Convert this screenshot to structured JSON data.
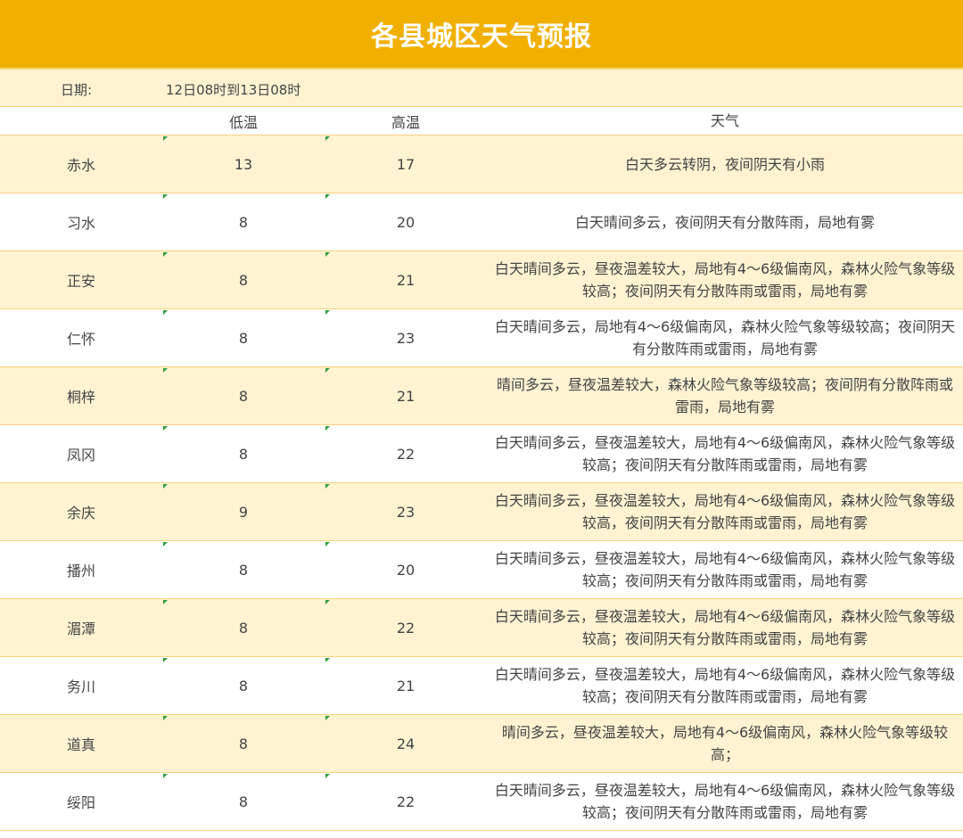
{
  "title": "各县城区天气预报",
  "date": {
    "label": "日期:",
    "value": "12日08时到13日08时"
  },
  "headers": {
    "city": "",
    "low": "低温",
    "high": "高温",
    "weather": "天气"
  },
  "rows": [
    {
      "city": "赤水",
      "low": "13",
      "high": "17",
      "weather": "白天多云转阴，夜间阴天有小雨"
    },
    {
      "city": "习水",
      "low": "8",
      "high": "20",
      "weather": "白天晴间多云，夜间阴天有分散阵雨，局地有雾"
    },
    {
      "city": "正安",
      "low": "8",
      "high": "21",
      "weather": "白天晴间多云，昼夜温差较大，局地有4～6级偏南风，森林火险气象等级较高；夜间阴天有分散阵雨或雷雨，局地有雾"
    },
    {
      "city": "仁怀",
      "low": "8",
      "high": "23",
      "weather": "白天晴间多云，局地有4～6级偏南风，森林火险气象等级较高；夜间阴天有分散阵雨或雷雨，局地有雾"
    },
    {
      "city": "桐梓",
      "low": "8",
      "high": "21",
      "weather": "晴间多云，昼夜温差较大，森林火险气象等级较高；夜间阴有分散阵雨或雷雨，局地有雾"
    },
    {
      "city": "凤冈",
      "low": "8",
      "high": "22",
      "weather": "白天晴间多云，昼夜温差较大，局地有4～6级偏南风，森林火险气象等级较高；夜间阴天有分散阵雨或雷雨，局地有雾"
    },
    {
      "city": "余庆",
      "low": "9",
      "high": "23",
      "weather": "白天晴间多云，昼夜温差较大，局地有4～6级偏南风，森林火险气象等级较高，夜间阴天有分散阵雨或雷雨，局地有雾"
    },
    {
      "city": "播州",
      "low": "8",
      "high": "20",
      "weather": "白天晴间多云，昼夜温差较大，局地有4～6级偏南风，森林火险气象等级较高；夜间阴天有分散阵雨或雷雨，局地有雾"
    },
    {
      "city": "湄潭",
      "low": "8",
      "high": "22",
      "weather": "白天晴间多云，昼夜温差较大，局地有4～6级偏南风，森林火险气象等级较高；夜间阴天有分散阵雨或雷雨，局地有雾"
    },
    {
      "city": "务川",
      "low": "8",
      "high": "21",
      "weather": "白天晴间多云，昼夜温差较大，局地有4～6级偏南风，森林火险气象等级较高；夜间阴天有分散阵雨或雷雨，局地有雾"
    },
    {
      "city": "道真",
      "low": "8",
      "high": "24",
      "weather": "晴间多云，昼夜温差较大，局地有4～6级偏南风，森林火险气象等级较高；"
    },
    {
      "city": "绥阳",
      "low": "8",
      "high": "22",
      "weather": "白天晴间多云，昼夜温差较大，局地有4～6级偏南风，森林火险气象等级较高；夜间阴天有分散阵雨或雷雨，局地有雾"
    }
  ],
  "colors": {
    "accent": "#f1b000",
    "row_alt": "#fff3d2",
    "border": "#f6d37e",
    "marker": "#2e9e3c"
  }
}
